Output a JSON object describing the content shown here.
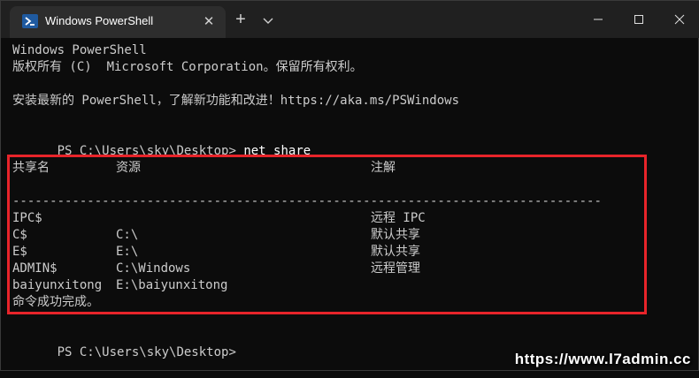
{
  "window": {
    "tab_title": "Windows PowerShell",
    "tab_close": "✕",
    "new_tab": "+"
  },
  "terminal": {
    "header_line1": "Windows PowerShell",
    "header_line2": "版权所有 (C)  Microsoft Corporation。保留所有权利。",
    "update_line": "安装最新的 PowerShell，了解新功能和改进！https://aka.ms/PSWindows",
    "prompt1": "PS C:\\Users\\sky\\Desktop>",
    "command": "net share",
    "columns": {
      "name": "共享名",
      "resource": "资源",
      "remark": "注解"
    },
    "separator": "-------------------------------------------------------------------------------",
    "shares": [
      {
        "name": "IPC$",
        "resource": "",
        "remark": "远程 IPC"
      },
      {
        "name": "C$",
        "resource": "C:\\",
        "remark": "默认共享"
      },
      {
        "name": "E$",
        "resource": "E:\\",
        "remark": "默认共享"
      },
      {
        "name": "ADMIN$",
        "resource": "C:\\Windows",
        "remark": "远程管理"
      },
      {
        "name": "baiyunxitong",
        "resource": "E:\\baiyunxitong",
        "remark": ""
      }
    ],
    "completion": "命令成功完成。",
    "prompt2": "PS C:\\Users\\sky\\Desktop>"
  },
  "watermark": "https://www.l7admin.cc",
  "colors": {
    "highlight_border": "#e8242a",
    "terminal_bg": "#0c0c0c",
    "terminal_fg": "#cccccc",
    "titlebar_bg": "#202020"
  }
}
